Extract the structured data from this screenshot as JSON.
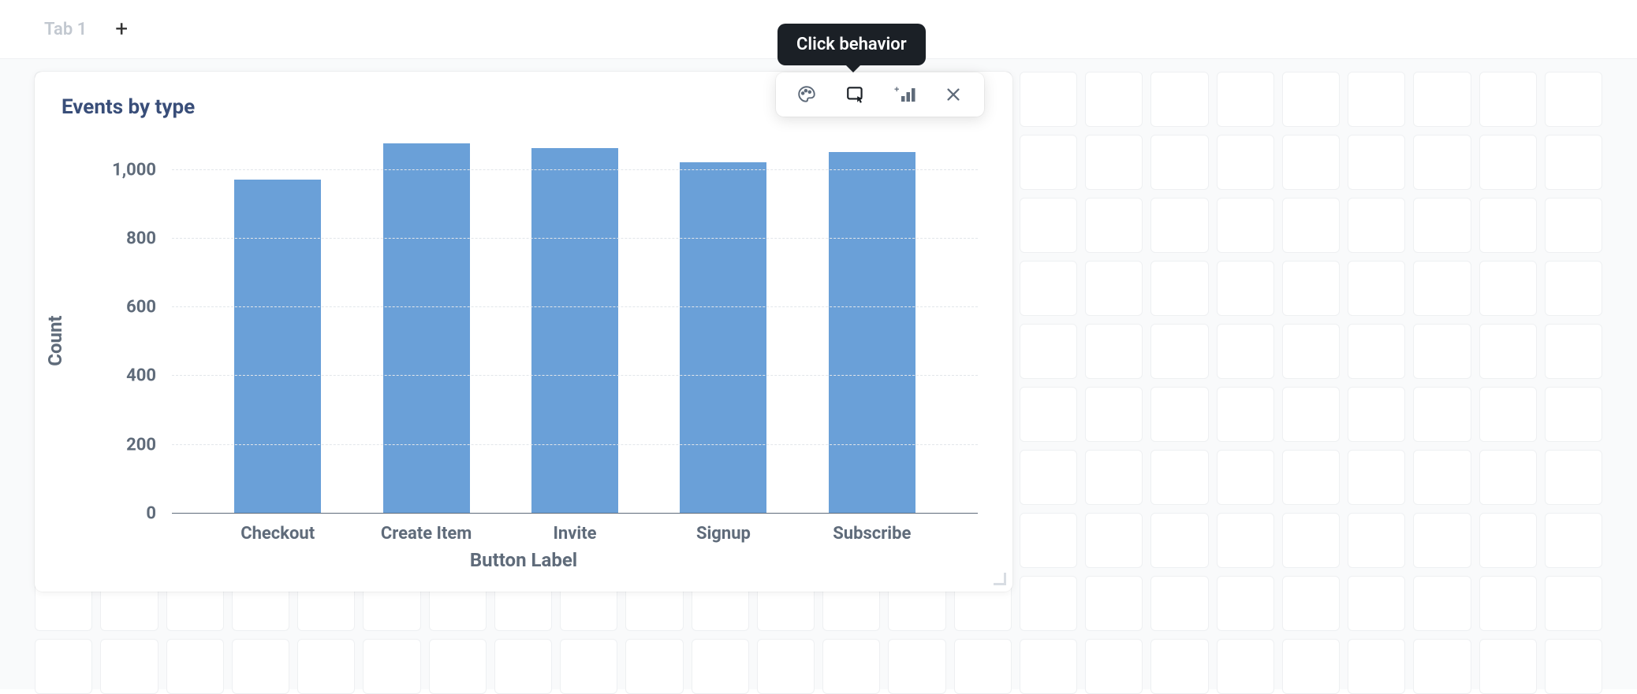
{
  "tabs": {
    "active": "Tab 1"
  },
  "tooltip": "Click behavior",
  "card": {
    "title": "Events by type"
  },
  "chart_data": {
    "type": "bar",
    "title": "Events by type",
    "xlabel": "Button Label",
    "ylabel": "Count",
    "ylim": [
      0,
      1100
    ],
    "yticks": [
      0,
      200,
      400,
      600,
      800,
      1000
    ],
    "ytick_labels": [
      "0",
      "200",
      "400",
      "600",
      "800",
      "1,000"
    ],
    "categories": [
      "Checkout",
      "Create Item",
      "Invite",
      "Signup",
      "Subscribe"
    ],
    "values": [
      970,
      1075,
      1060,
      1020,
      1050
    ]
  },
  "colors": {
    "bar": "#6aa0d8",
    "axis_text": "#5f6b7a",
    "title": "#394e79"
  }
}
